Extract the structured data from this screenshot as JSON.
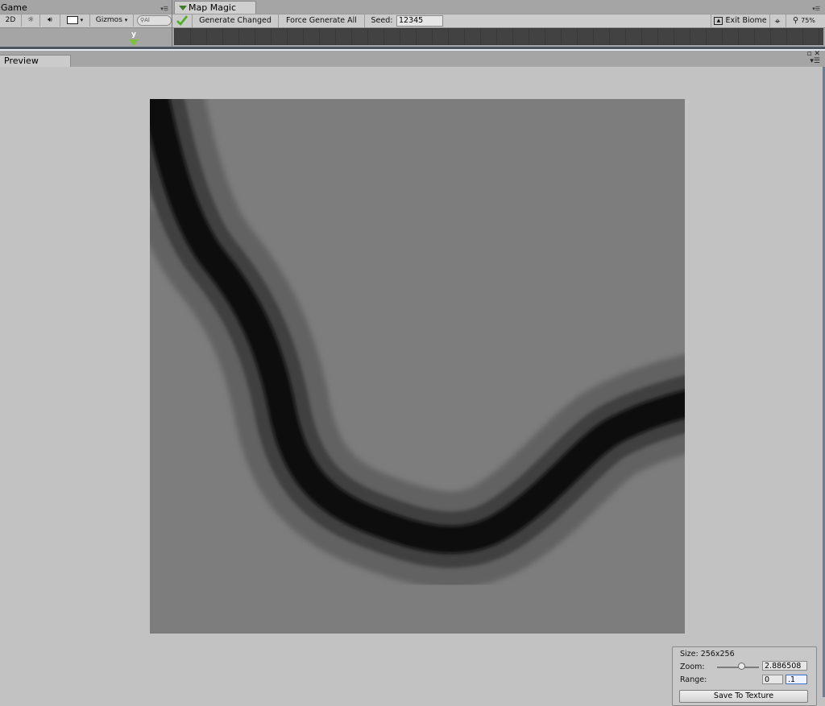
{
  "game": {
    "tab_label": "Game",
    "menu_icon": "panel-menu-icon",
    "btn_2d": "2D",
    "gizmos_label": "Gizmos",
    "search_placeholder": "Al",
    "axis_label": "y"
  },
  "map_magic": {
    "tab_label": "Map Magic",
    "generate_changed": "Generate Changed",
    "force_generate_all": "Force Generate All",
    "seed_label": "Seed:",
    "seed_value": "12345",
    "exit_biome": "Exit Biome",
    "zoom_percent": "75%",
    "accent_green": "#4caf24"
  },
  "preview": {
    "tab_label": "Preview",
    "size_text": "Size: 256x256",
    "zoom_label": "Zoom:",
    "zoom_value": "2.886508",
    "range_label": "Range:",
    "range_min": "0",
    "range_max": ".1",
    "save_button": "Save To Texture"
  }
}
